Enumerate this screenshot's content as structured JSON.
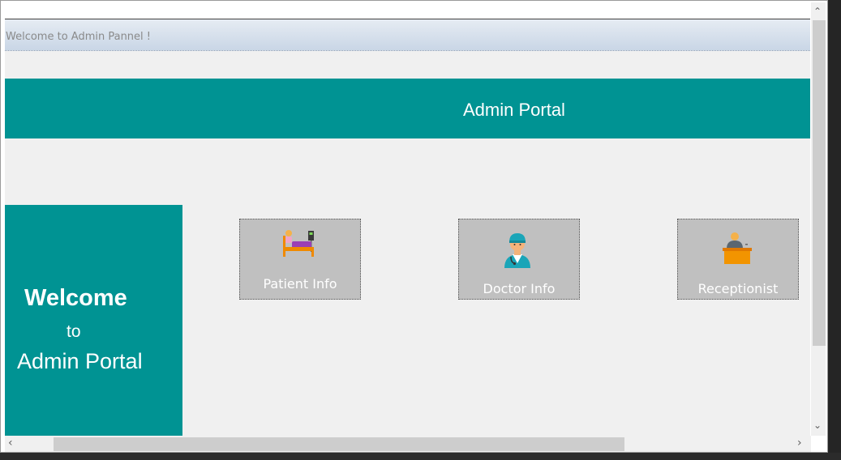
{
  "status_bar": {
    "text": "Welcome to Admin Pannel !"
  },
  "header": {
    "title": "Admin Portal"
  },
  "side_panel": {
    "line1": "Welcome",
    "line2": "to",
    "line3": "Admin Portal"
  },
  "tiles": [
    {
      "label": "Patient Info",
      "icon": "patient-bed-icon"
    },
    {
      "label": "Doctor Info",
      "icon": "doctor-icon"
    },
    {
      "label": "Receptionist",
      "icon": "receptionist-desk-icon"
    }
  ],
  "colors": {
    "teal": "#009393",
    "tile_bg": "#c0c0c0",
    "form_bg": "#f0f0f0"
  }
}
